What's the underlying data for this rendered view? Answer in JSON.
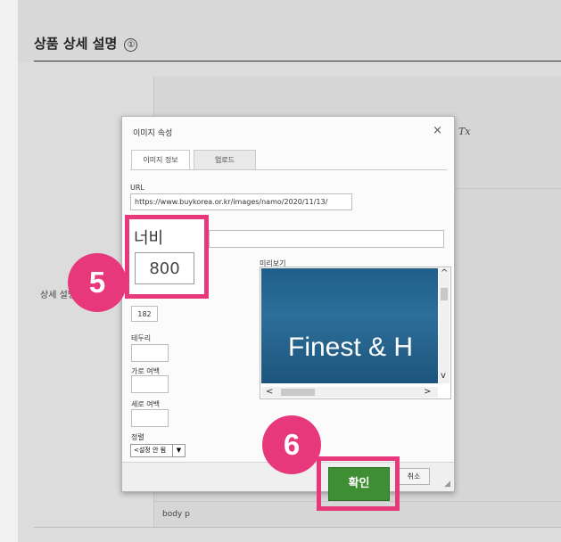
{
  "page": {
    "section_title": "상품 상세 설명",
    "info_icon": "①",
    "field_label": "상세 설명",
    "status_bar": "body  p",
    "toolbar_icon": "Tx"
  },
  "dialog": {
    "title": "이미지 속성",
    "close": "×",
    "tabs": [
      "이미지 정보",
      "업로드"
    ],
    "url_label": "URL",
    "url_value": "https://www.buykorea.or.kr/images/namo/2020/11/13/",
    "width_label": "너비",
    "width_value": "800",
    "height_value": "182",
    "border_label": "테두리",
    "hspace_label": "가로 여백",
    "vspace_label": "세로 여백",
    "align_label": "정렬",
    "align_value": "<설정 안 됨",
    "preview_label": "미리보기",
    "preview_text": "Finest & H",
    "ok_button": "확인",
    "cancel_button": "취소"
  },
  "annotations": {
    "step_width": "5",
    "step_ok": "6",
    "highlight_color": "#e8387c"
  },
  "colors": {
    "ok_button": "#3e8f33",
    "preview_bg": "#1f5f89"
  }
}
